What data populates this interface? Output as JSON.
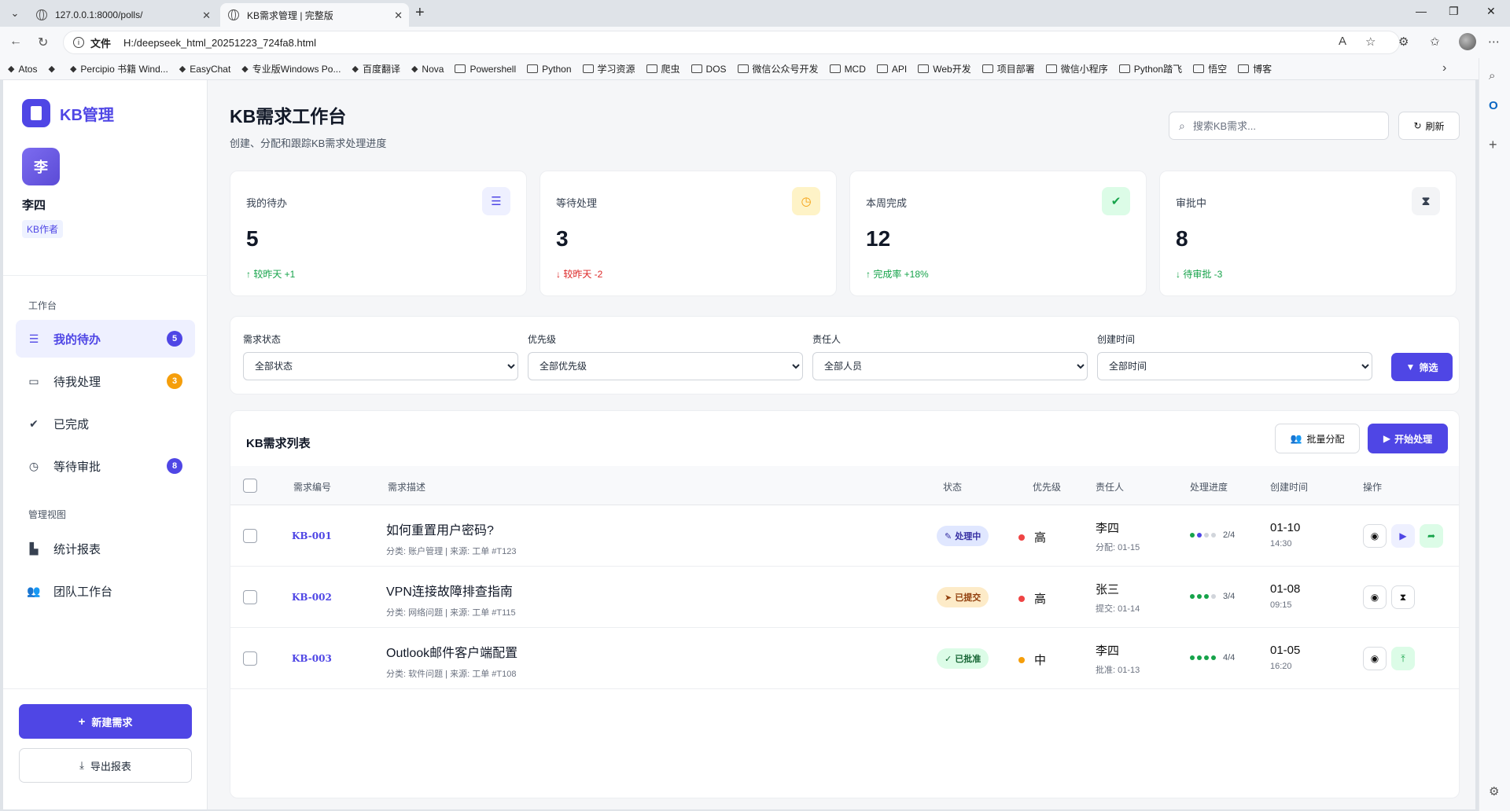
{
  "browser": {
    "tabs": [
      {
        "title": "127.0.0.1:8000/polls/"
      },
      {
        "title": "KB需求管理 | 完整版"
      }
    ],
    "url_scheme": "文件",
    "url": "H:/deepseek_html_20251223_724fa8.html",
    "bookmarks": [
      "Atos",
      "",
      "Percipio 书籍 Wind...",
      "EasyChat",
      "专业版Windows Po...",
      "百度翻译",
      "Nova",
      "Powershell",
      "Python",
      "学习资源",
      "爬虫",
      "DOS",
      "微信公众号开发",
      "MCD",
      "API",
      "Web开发",
      "项目部署",
      "微信小程序",
      "Python踏飞",
      "悟空",
      "博客"
    ]
  },
  "sidebar": {
    "logo_text": "KB管理",
    "user": {
      "avatar_text": "李",
      "name": "李四",
      "role": "KB作者"
    },
    "section_work": "工作台",
    "nav": [
      {
        "label": "我的待办",
        "badge": "5",
        "icon": "list-check-icon"
      },
      {
        "label": "待我处理",
        "badge": "3",
        "icon": "inbox-icon"
      },
      {
        "label": "已完成",
        "badge": "",
        "icon": "check-circle-icon"
      },
      {
        "label": "等待审批",
        "badge": "8",
        "icon": "clock-icon"
      }
    ],
    "section_manage": "管理视图",
    "manage_nav": [
      {
        "label": "统计报表",
        "icon": "chart-icon"
      },
      {
        "label": "团队工作台",
        "icon": "users-icon"
      }
    ],
    "new_button": "新建需求",
    "export_button": "导出报表"
  },
  "header": {
    "title": "KB需求工作台",
    "subtitle": "创建、分配和跟踪KB需求处理进度",
    "search_placeholder": "搜索KB需求...",
    "refresh_label": "刷新"
  },
  "stats": [
    {
      "label": "我的待办",
      "value": "5",
      "trend": "较昨天 +1",
      "direction": "up",
      "icon": "list-check-icon",
      "icon_bg": "#eef0ff",
      "icon_color": "#4f46e5"
    },
    {
      "label": "等待处理",
      "value": "3",
      "trend": "较昨天 -2",
      "direction": "down",
      "icon": "clock-icon",
      "icon_bg": "#fef3c7",
      "icon_color": "#f59e0b"
    },
    {
      "label": "本周完成",
      "value": "12",
      "trend": "完成率 +18%",
      "direction": "up",
      "icon": "check-circle-icon",
      "icon_bg": "#dcfce7",
      "icon_color": "#16a34a"
    },
    {
      "label": "审批中",
      "value": "8",
      "trend": "待审批 -3",
      "direction": "up",
      "icon": "hourglass-icon",
      "icon_bg": "#f3f4f6",
      "icon_color": "#374151"
    }
  ],
  "filters": [
    {
      "label": "需求状态",
      "value": "全部状态"
    },
    {
      "label": "优先级",
      "value": "全部优先级"
    },
    {
      "label": "责任人",
      "value": "全部人员"
    },
    {
      "label": "创建时间",
      "value": "全部时间"
    }
  ],
  "filter_button": "筛选",
  "table": {
    "title": "KB需求列表",
    "batch_button": "批量分配",
    "start_button": "开始处理",
    "columns": [
      "需求编号",
      "需求描述",
      "状态",
      "优先级",
      "责任人",
      "处理进度",
      "创建时间",
      "操作"
    ],
    "rows": [
      {
        "id": "KB-001",
        "title": "如何重置用户密码?",
        "meta": "分类: 账户管理 | 来源: 工单 #T123",
        "status": "处理中",
        "status_icon": "pencil-icon",
        "status_bg": "#e0e7ff",
        "status_color": "#3730a3",
        "priority": "高",
        "priority_color": "#ef4444",
        "owner": "李四",
        "owner_sub": "分配: 01-15",
        "progress": "2/4",
        "progress_done": 2,
        "date": "01-10",
        "time": "14:30",
        "actions": [
          "eye-icon",
          "play-icon",
          "share-icon"
        ]
      },
      {
        "id": "KB-002",
        "title": "VPN连接故障排查指南",
        "meta": "分类: 网络问题 | 来源: 工单 #T115",
        "status": "已提交",
        "status_icon": "paper-plane-icon",
        "status_bg": "#fdebc8",
        "status_color": "#92400e",
        "priority": "高",
        "priority_color": "#ef4444",
        "owner": "张三",
        "owner_sub": "提交: 01-14",
        "progress": "3/4",
        "progress_done": 3,
        "date": "01-08",
        "time": "09:15",
        "actions": [
          "eye-icon",
          "hourglass-icon"
        ]
      },
      {
        "id": "KB-003",
        "title": "Outlook邮件客户端配置",
        "meta": "分类: 软件问题 | 来源: 工单 #T108",
        "status": "已批准",
        "status_icon": "check-icon",
        "status_bg": "#dcfce7",
        "status_color": "#166534",
        "priority": "中",
        "priority_color": "#f59e0b",
        "owner": "李四",
        "owner_sub": "批准: 01-13",
        "progress": "4/4",
        "progress_done": 4,
        "date": "01-05",
        "time": "16:20",
        "actions": [
          "eye-icon",
          "upload-icon"
        ]
      }
    ]
  },
  "colors": {
    "accent": "#4f46e5",
    "badge_purple": "#4f46e5",
    "badge_orange": "#f59e0b",
    "success": "#16a34a",
    "danger": "#dc2626"
  }
}
